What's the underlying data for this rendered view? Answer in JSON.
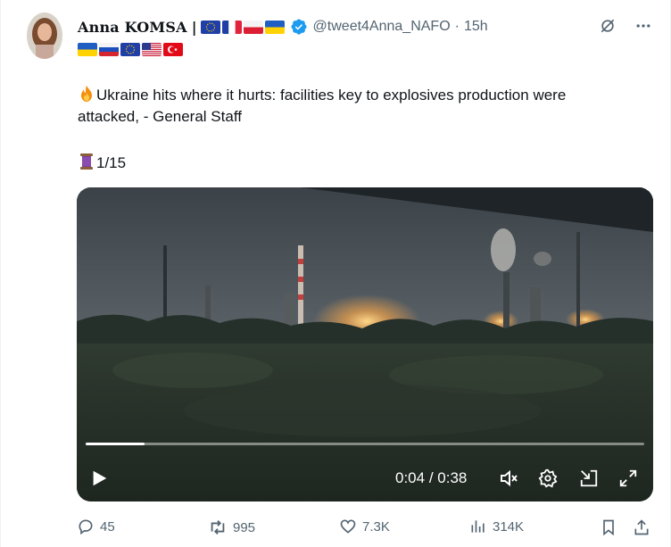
{
  "author": {
    "name": "Anna KOMSA",
    "separator": "|",
    "handle": "@tweet4Anna_NAFO",
    "dot": "·",
    "time_ago": "15h"
  },
  "flags_row1": [
    "eu-flag",
    "france-flag",
    "poland-flag",
    "ukraine-flag"
  ],
  "flags_row2": [
    "ukraine-flag",
    "russia-flag",
    "eu-flag",
    "usa-flag",
    "turkey-flag"
  ],
  "tweet": {
    "line1": "Ukraine hits where it hurts: facilities key to explosives production were",
    "line2": "attacked, - General Staff",
    "thread_counter": "1/15",
    "emoji_fire": "fire-emoji",
    "emoji_thread": "thread-spool-emoji"
  },
  "video": {
    "current_time": "0:04",
    "time_separator": "/",
    "duration": "0:38",
    "progress_fraction": 0.105,
    "controls": [
      "play-icon",
      "mute-icon",
      "settings-icon",
      "pip-icon",
      "fullscreen-icon"
    ]
  },
  "stats": {
    "replies": "45",
    "reposts": "995",
    "likes": "7.3K",
    "views": "314K"
  },
  "colors": {
    "text": "#0f1419",
    "secondary": "#536471",
    "verified": "#1d9bf0",
    "media_bg": "#2a3136"
  }
}
